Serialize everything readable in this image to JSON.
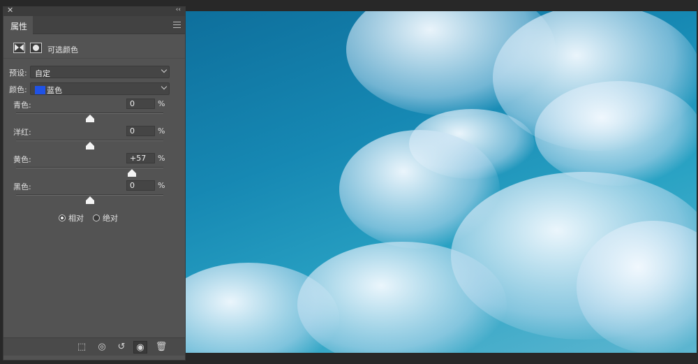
{
  "panel": {
    "close_glyph": "✕",
    "collapse_glyph": "‹‹",
    "tab_label": "属性",
    "adjustment_title": "可选颜色",
    "preset": {
      "label": "预设:",
      "value": "自定"
    },
    "color": {
      "label": "颜色:",
      "value": "蓝色",
      "swatch": "#1f52e6"
    },
    "sliders": [
      {
        "label": "青色:",
        "value": "0",
        "unit": "%",
        "position": 0.5
      },
      {
        "label": "洋红:",
        "value": "0",
        "unit": "%",
        "position": 0.5
      },
      {
        "label": "黄色:",
        "value": "+57",
        "unit": "%",
        "position": 0.785
      },
      {
        "label": "黑色:",
        "value": "0",
        "unit": "%",
        "position": 0.5
      }
    ],
    "method": {
      "relative": "相对",
      "absolute": "绝对",
      "selected": "relative"
    },
    "bottom_tools": [
      {
        "name": "clip-to-layer-icon",
        "glyph": "⬚"
      },
      {
        "name": "view-previous-state-icon",
        "glyph": "◎"
      },
      {
        "name": "reset-icon",
        "glyph": "↺"
      },
      {
        "name": "visibility-icon",
        "glyph": "◉"
      },
      {
        "name": "trash-icon",
        "glyph": "🗑"
      }
    ]
  }
}
